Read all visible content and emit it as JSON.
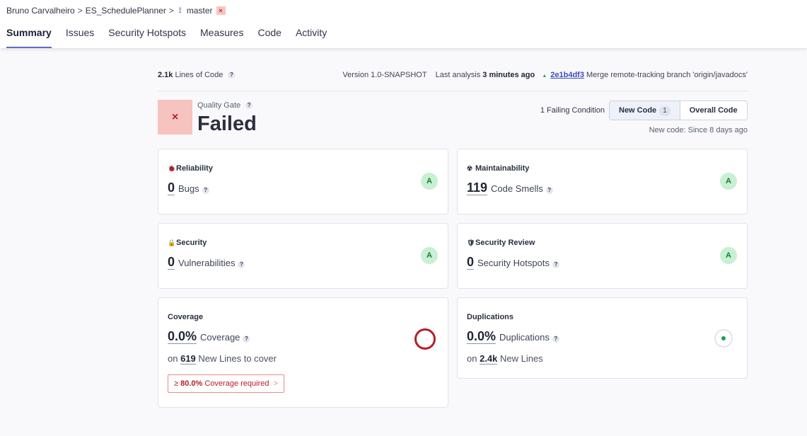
{
  "breadcrumb": {
    "owner": "Bruno Carvalheiro",
    "project": "ES_SchedulePlanner",
    "separator": ">",
    "branch": "master",
    "branch_icon": "⟟",
    "status_icon": "×"
  },
  "tabs": [
    "Summary",
    "Issues",
    "Security Hotspots",
    "Measures",
    "Code",
    "Activity"
  ],
  "info": {
    "loc_value": "2.1k",
    "loc_label": "Lines of Code",
    "version": "Version 1.0-SNAPSHOT",
    "last_analysis_label": "Last analysis",
    "last_analysis_value": "3 minutes ago",
    "commit_hash": "2e1b4df3",
    "commit_message": "Merge remote-tracking branch 'origin/javadocs'"
  },
  "quality_gate": {
    "label": "Quality Gate",
    "status": "Failed",
    "icon": "×",
    "failing_conditions": "1 Failing Condition",
    "new_code_label": "New Code",
    "new_code_count": "1",
    "overall_code_label": "Overall Code",
    "since": "New code: Since 8 days ago"
  },
  "help_glyph": "?",
  "cards": {
    "reliability": {
      "title": "Reliability",
      "icon": "🐞",
      "value": "0",
      "label": "Bugs",
      "rating": "A"
    },
    "maintainability": {
      "title": "Maintainability",
      "icon": "☢",
      "value": "119",
      "label": "Code Smells",
      "rating": "A"
    },
    "security": {
      "title": "Security",
      "icon": "🔒",
      "value": "0",
      "label": "Vulnerabilities",
      "rating": "A"
    },
    "security_review": {
      "title": "Security Review",
      "icon": "🛡",
      "value": "0",
      "label": "Security Hotspots",
      "rating": "A"
    },
    "coverage": {
      "title": "Coverage",
      "value": "0.0%",
      "label": "Coverage",
      "sub_prefix": "on",
      "sub_value": "619",
      "sub_label": "New Lines to cover",
      "req_prefix": "≥",
      "req_value": "80.0%",
      "req_label": "Coverage required",
      "req_chevron": ">"
    },
    "duplications": {
      "title": "Duplications",
      "value": "0.0%",
      "label": "Duplications",
      "sub_prefix": "on",
      "sub_value": "2.4k",
      "sub_label": "New Lines"
    }
  },
  "colors": {
    "accent": "#5d6cd0",
    "failed_bg": "#f6c3be",
    "failed_fg": "#b51f2a",
    "rating_bg": "#c8f0d2"
  }
}
